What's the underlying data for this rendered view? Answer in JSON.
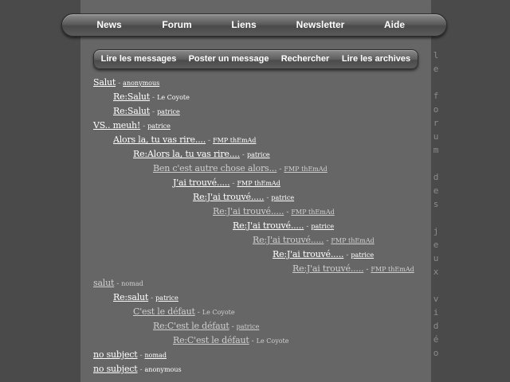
{
  "top_nav": [
    {
      "label": "News"
    },
    {
      "label": "Forum"
    },
    {
      "label": "Liens"
    },
    {
      "label": "Newsletter"
    },
    {
      "label": "Aide"
    }
  ],
  "sub_nav": [
    {
      "label": "Lire les messages"
    },
    {
      "label": "Poster un message"
    },
    {
      "label": "Rechercher"
    },
    {
      "label": "Lire les archives"
    }
  ],
  "side_text": "le forum des jeux vidéo",
  "separator": "-",
  "messages": [
    {
      "subject": "Salut",
      "author": "anonymous",
      "author_link": true,
      "depth": 0,
      "dim": false
    },
    {
      "subject": "Re:Salut",
      "author": "Le Coyote",
      "author_link": false,
      "depth": 1,
      "dim": false
    },
    {
      "subject": "Re:Salut",
      "author": "patrice",
      "author_link": true,
      "depth": 1,
      "dim": false
    },
    {
      "subject": "VS.. meuh!",
      "author": "patrice",
      "author_link": true,
      "depth": 0,
      "dim": false
    },
    {
      "subject": "Alors la, tu vas rire....",
      "author": "FMP thEmAd",
      "author_link": true,
      "depth": 1,
      "dim": false
    },
    {
      "subject": "Re:Alors la, tu vas rire....",
      "author": "patrice",
      "author_link": true,
      "depth": 2,
      "dim": false
    },
    {
      "subject": "Ben c'est autre chose alors...",
      "author": "FMP thEmAd",
      "author_link": true,
      "depth": 3,
      "dim": true
    },
    {
      "subject": "J'ai trouvé.....",
      "author": "FMP thEmAd",
      "author_link": true,
      "depth": 4,
      "dim": false
    },
    {
      "subject": "Re:J'ai trouvé.....",
      "author": "patrice",
      "author_link": true,
      "depth": 5,
      "dim": false
    },
    {
      "subject": "Re:J'ai trouvé.....",
      "author": "FMP thEmAd",
      "author_link": true,
      "depth": 6,
      "dim": true
    },
    {
      "subject": "Re:J'ai trouvé.....",
      "author": "patrice",
      "author_link": true,
      "depth": 7,
      "dim": false
    },
    {
      "subject": "Re:J'ai trouvé.....",
      "author": "FMP thEmAd",
      "author_link": true,
      "depth": 8,
      "dim": true
    },
    {
      "subject": "Re:J'ai trouvé.....",
      "author": "patrice",
      "author_link": true,
      "depth": 9,
      "dim": false
    },
    {
      "subject": "Re:J'ai trouvé.....",
      "author": "FMP thEmAd",
      "author_link": true,
      "depth": 10,
      "dim": true
    },
    {
      "subject": "salut",
      "author": "nomad",
      "author_link": false,
      "depth": 0,
      "dim": true
    },
    {
      "subject": "Re:salut",
      "author": "patrice",
      "author_link": true,
      "depth": 1,
      "dim": false
    },
    {
      "subject": "C'est le défaut",
      "author": "Le Coyote",
      "author_link": false,
      "depth": 2,
      "dim": true
    },
    {
      "subject": "Re:C'est le défaut",
      "author": "patrice",
      "author_link": true,
      "depth": 3,
      "dim": true
    },
    {
      "subject": "Re:C'est le défaut",
      "author": "Le Coyote",
      "author_link": false,
      "depth": 4,
      "dim": true
    },
    {
      "subject": "no subject",
      "author": "nomad",
      "author_link": true,
      "depth": 0,
      "dim": false
    },
    {
      "subject": "no subject",
      "author": "anonymous",
      "author_link": false,
      "depth": 0,
      "dim": false
    }
  ]
}
